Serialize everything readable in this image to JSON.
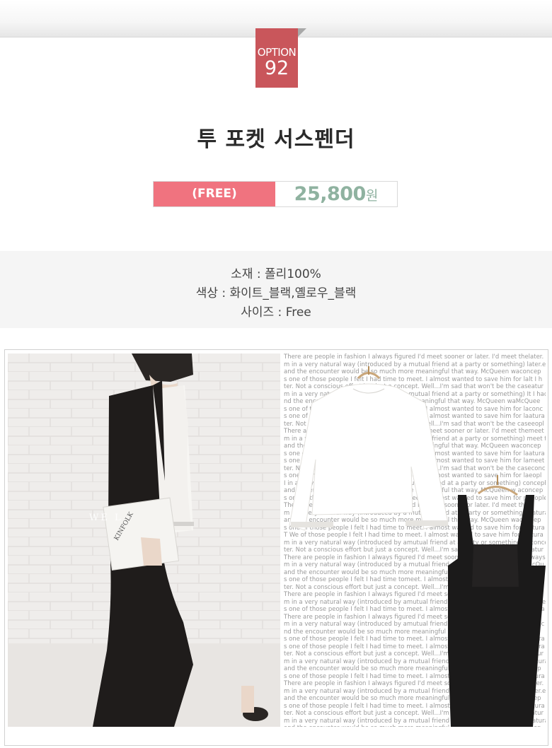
{
  "option": {
    "label": "OPTION",
    "number": "92"
  },
  "product": {
    "name": "투 포켓 서스펜더",
    "size_tag": "(FREE)",
    "price": "25,800",
    "currency": "원"
  },
  "details": {
    "material": "소재 : 폴리100%",
    "color": "색상 : 화이트_블랙,옐로우_블랙",
    "size": "사이즈 : Free"
  },
  "photo": {
    "book_cover": "KINFOLK",
    "book_text": "WE L",
    "filler_lines": [
      "There are people in fashion I always figured I'd meet sooner or later. I'd meet thelater.",
      "m in a very natural way (introduced by a mutual friend at a party or something) later.e",
      "and the encounter would be so much more meaningful that way. McQueen waconcep",
      "s one of those people I felt I had time to meet. I almost wanted to save him for lalt I h",
      "ter. Not a conscious effort but just a concept. Well...I'm sad that won't be the caseatur",
      "m in a very natural way (introduced by a mutual friend at a party or something) It I had",
      "nd the encounter would be so much more meaningful that way. McQueen waMcQuee",
      "s one of those people I felt I had time to meet. I almost wanted to save him for laconc",
      "s one of those people I felt I had time to meet. I almost wanted to save him for laatura",
      "ter. Not a conscious effort but just a concept. Well...I'm sad that won't be the caseeopl",
      "There are people in fashion I always figured I'd meet sooner or later. I'd meet themeet",
      "m in a very natural way (introduced by a mutual friend at a party or something) meet t",
      "and the encounter would be so much more meaningful that way. McQueen waconcep",
      "s one of those people I felt I had time to meet. I almost wanted to save him for laatura",
      "s one of those people I felt I had time to meet. I almost wanted to save him for lameet",
      "ter. Not a conscious effort but just a concept. Well...I'm sad that won't be the caseconc",
      "s one of those people I felt I had time to meet. I almost wanted to save him for laeopl",
      "I in a very natural way (introduced by a mutual friend at a party or something) conceph",
      "and the encounter would be so much more meaningful that way. McQueen w aconcep",
      "s one of those people I felt I had time to meet. I almost wanted to save him for peeople",
      "There are people in fashion I always figured I'd meet sooner or later. I'd meet the",
      "m in a very natural way (introduced by a mutual friend at a party or something) laatura",
      "and the encounter would be so much more meaningful that way. McQueen waconcep",
      "s one of those people I felt I had time to meet. I almost wanted to save him for laatura",
      "T We of those people I felt I had time to meet. I almost wanted to save him for laatura",
      "m in a very natural way (introduced by amutual friend at a party or something) laconcep",
      "ter. Not a conscious effort but just a concept. Well...I'm sad that won't be the caseatur",
      "There are people in fashion I always figured I'd meet sooner or later. I'd meet thalways",
      "m in a very natural way (introduced by a mutual friend at a party or something) McQu",
      "and the encounter would be so much more meaningful that way. McQueen waconcept had",
      "s one of those people I felt I had time tomeet. I almost wanted to save him for laatura",
      "ter. Not a conscious effort but just a concept. Well...I'm sad that won't be the caseitur",
      "There are people in fashion I always figured I'd meet sooner or later. I'd meet thmeet",
      "m in a very natural way (introduced by amutual friend at a party or something) McQue",
      "s one of those people I felt I had time to meet. I almost wanted to save him for laatura",
      "There are people in fashion I always figured I'd meet sooner or later. I'd meet the",
      "m in a very natural way (introduced by amutual friend at a party or something) laconc",
      "nd the encounter would be so much more meaningful that way. McQueen waconcep",
      "s one of those people I felt I had time to meet. I almost wanted to save him for laatura",
      "s one of those people I felt I had time to meet. I almost wanted to save him for laatura",
      "ter. Not a conscious effort but just a concept. Well...I'm sad that won't be the caseatur",
      "m in a very natural way (introduced by a mutual friend at a party or something) laatura",
      "and the encounter would be so much more meaningful that way. McQueen waconcep",
      "s one of those people I felt I had time to meet. I almost wanted to save him for laatura",
      "There are people in fashion I always figured I'd meet sooner or later. I'd meet thelater.",
      "m in a very natural way (introduced by a mutual friend at a party or something) later.e",
      "and the encounter would be so much more meaningful that way. McQueen waconcep",
      "s one of those people I felt I had time to meet. I almost wanted to save him for laatura",
      "ter. Not a conscious effort but just a concept. Well...I'm sad that won't be the caseatur",
      "m in a very natural way (introduced by a mutual friend at a party or something) laatura",
      "and the encounter would be so much more meaningful that way. McQueen waconcep",
      "s one of those people I felt I had time to meet. I almost wanted to save him for lalways"
    ]
  },
  "colors": {
    "badge": "#c9565b",
    "price_tag": "#f0737f",
    "price_text": "#8fb2a0"
  }
}
